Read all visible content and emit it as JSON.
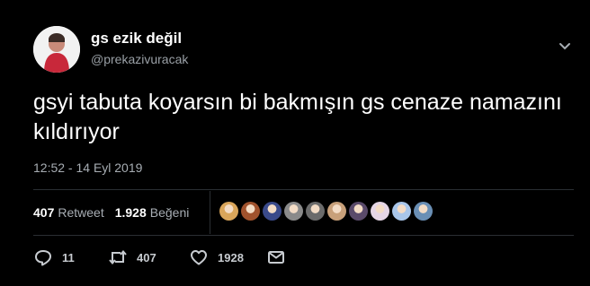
{
  "user": {
    "display_name": "gs ezik değil",
    "handle": "@prekazivuracak"
  },
  "tweet": {
    "text": "gsyi tabuta koyarsın bi bakmışın gs cenaze namazını kıldırıyor",
    "timestamp": "12:52 - 14 Eyl 2019"
  },
  "stats": {
    "retweet_count": "407",
    "retweet_label": "Retweet",
    "like_count": "1.928",
    "like_label": "Beğeni"
  },
  "likers": [
    {
      "color": "#d9a55a"
    },
    {
      "color": "#a0522d"
    },
    {
      "color": "#3a4a8a"
    },
    {
      "color": "#8a8a8a"
    },
    {
      "color": "#6b6b6b"
    },
    {
      "color": "#c8a07a"
    },
    {
      "color": "#5a4a6a"
    },
    {
      "color": "#e6d6e6"
    },
    {
      "color": "#a9c6ea"
    },
    {
      "color": "#6a8fb5"
    }
  ],
  "actions": {
    "reply_count": "11",
    "retweet_count": "407",
    "like_count": "1928"
  },
  "icons": {
    "menu": "chevron-down-icon",
    "reply": "reply-icon",
    "retweet": "retweet-icon",
    "like": "heart-icon",
    "dm": "envelope-icon"
  },
  "colors": {
    "background": "#000000",
    "text": "#ffffff",
    "secondary": "#a7adb3",
    "divider": "#2a2e33"
  }
}
